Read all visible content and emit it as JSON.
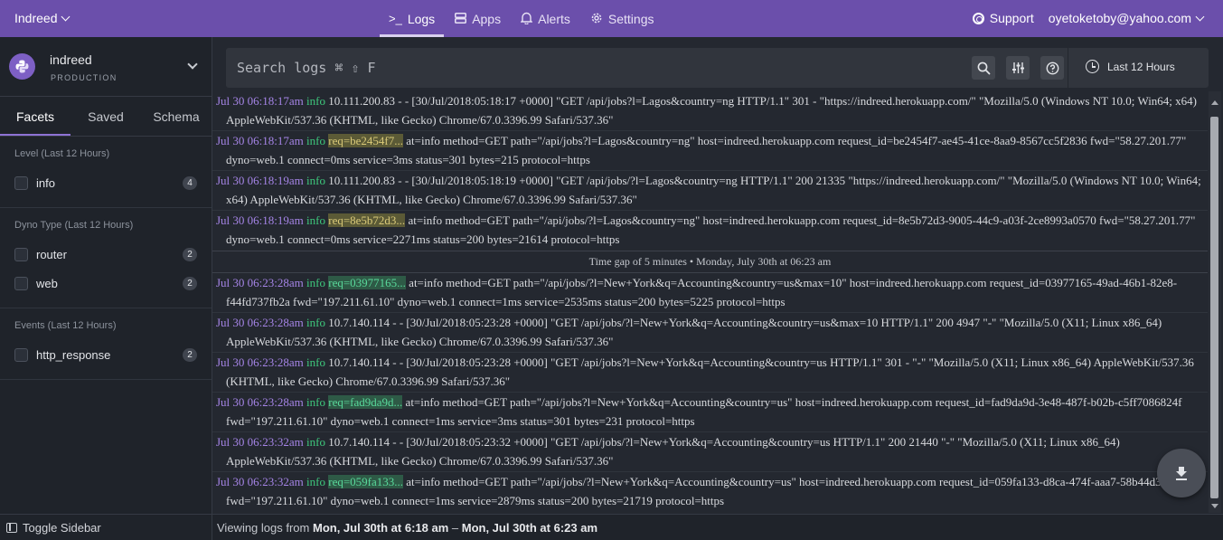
{
  "topbar": {
    "app_switcher": "Indreed",
    "nav": [
      {
        "label": "Logs",
        "icon": "terminal-icon"
      },
      {
        "label": "Apps",
        "icon": "apps-icon"
      },
      {
        "label": "Alerts",
        "icon": "bell-icon"
      },
      {
        "label": "Settings",
        "icon": "gear-icon"
      }
    ],
    "support": "Support",
    "user": "oyetoketoby@yahoo.com",
    "accent_color": "#6b4fab"
  },
  "sidebar": {
    "app": {
      "name": "indreed",
      "env": "PRODUCTION"
    },
    "tabs": [
      "Facets",
      "Saved",
      "Schema"
    ],
    "groups": [
      {
        "title": "Level (Last 12 Hours)",
        "items": [
          {
            "label": "info",
            "count": "4"
          }
        ]
      },
      {
        "title": "Dyno Type (Last 12 Hours)",
        "items": [
          {
            "label": "router",
            "count": "2"
          },
          {
            "label": "web",
            "count": "2"
          }
        ]
      },
      {
        "title": "Events (Last 12 Hours)",
        "items": [
          {
            "label": "http_response",
            "count": "2"
          }
        ]
      }
    ],
    "toggle_label": "Toggle Sidebar"
  },
  "search": {
    "placeholder": "Search logs ⌘ ⇧ F",
    "time_range": "Last 12 Hours"
  },
  "logs": [
    {
      "ts": "Jul 30 06:18:17am",
      "level": "info",
      "req": "",
      "text": "10.111.200.83 - - [30/Jul/2018:05:18:17 +0000] \"GET /api/jobs?l=Lagos&country=ng HTTP/1.1\" 301 - \"https://indreed.herokuapp.com/\" \"Mozilla/5.0 (Windows NT 10.0; Win64; x64) AppleWebKit/537.36 (KHTML, like Gecko) Chrome/67.0.3396.99 Safari/537.36\""
    },
    {
      "ts": "Jul 30 06:18:17am",
      "level": "info",
      "req": "req=be2454f7...",
      "req_style": "y",
      "text": "at=info method=GET path=\"/api/jobs?l=Lagos&country=ng\" host=indreed.herokuapp.com request_id=be2454f7-ae45-41ce-8aa9-8567cc5f2836 fwd=\"58.27.201.77\" dyno=web.1 connect=0ms service=3ms status=301 bytes=215 protocol=https"
    },
    {
      "ts": "Jul 30 06:18:19am",
      "level": "info",
      "req": "",
      "text": "10.111.200.83 - - [30/Jul/2018:05:18:19 +0000] \"GET /api/jobs/?l=Lagos&country=ng HTTP/1.1\" 200 21335 \"https://indreed.herokuapp.com/\" \"Mozilla/5.0 (Windows NT 10.0; Win64; x64) AppleWebKit/537.36 (KHTML, like Gecko) Chrome/67.0.3396.99 Safari/537.36\""
    },
    {
      "ts": "Jul 30 06:18:19am",
      "level": "info",
      "req": "req=8e5b72d3...",
      "req_style": "y",
      "text": "at=info method=GET path=\"/api/jobs/?l=Lagos&country=ng\" host=indreed.herokuapp.com request_id=8e5b72d3-9005-44c9-a03f-2ce8993a0570 fwd=\"58.27.201.77\" dyno=web.1 connect=0ms service=2271ms status=200 bytes=21614 protocol=https"
    },
    {
      "ts": "Jul 30 06:23:28am",
      "level": "info",
      "req": "req=03977165...",
      "req_style": "g",
      "text": "at=info method=GET path=\"/api/jobs/?l=New+York&q=Accounting&country=us&max=10\" host=indreed.herokuapp.com request_id=03977165-49ad-46b1-82e8-f44fd737fb2a fwd=\"197.211.61.10\" dyno=web.1 connect=1ms service=2535ms status=200 bytes=5225 protocol=https"
    },
    {
      "ts": "Jul 30 06:23:28am",
      "level": "info",
      "req": "",
      "text": "10.7.140.114 - - [30/Jul/2018:05:23:28 +0000] \"GET /api/jobs/?l=New+York&q=Accounting&country=us&max=10 HTTP/1.1\" 200 4947 \"-\" \"Mozilla/5.0 (X11; Linux x86_64) AppleWebKit/537.36 (KHTML, like Gecko) Chrome/67.0.3396.99 Safari/537.36\""
    },
    {
      "ts": "Jul 30 06:23:28am",
      "level": "info",
      "req": "",
      "text": "10.7.140.114 - - [30/Jul/2018:05:23:28 +0000] \"GET /api/jobs?l=New+York&q=Accounting&country=us HTTP/1.1\" 301 - \"-\" \"Mozilla/5.0 (X11; Linux x86_64) AppleWebKit/537.36 (KHTML, like Gecko) Chrome/67.0.3396.99 Safari/537.36\""
    },
    {
      "ts": "Jul 30 06:23:28am",
      "level": "info",
      "req": "req=fad9da9d...",
      "req_style": "g",
      "text": "at=info method=GET path=\"/api/jobs?l=New+York&q=Accounting&country=us\" host=indreed.herokuapp.com request_id=fad9da9d-3e48-487f-b02b-c5ff7086824f fwd=\"197.211.61.10\" dyno=web.1 connect=1ms service=3ms status=301 bytes=231 protocol=https"
    },
    {
      "ts": "Jul 30 06:23:32am",
      "level": "info",
      "req": "",
      "text": "10.7.140.114 - - [30/Jul/2018:05:23:32 +0000] \"GET /api/jobs/?l=New+York&q=Accounting&country=us HTTP/1.1\" 200 21440 \"-\" \"Mozilla/5.0 (X11; Linux x86_64) AppleWebKit/537.36 (KHTML, like Gecko) Chrome/67.0.3396.99 Safari/537.36\""
    },
    {
      "ts": "Jul 30 06:23:32am",
      "level": "info",
      "req": "req=059fa133...",
      "req_style": "g",
      "text": "at=info method=GET path=\"/api/jobs/?l=New+York&q=Accounting&country=us\" host=indreed.herokuapp.com request_id=059fa133-d8ca-474f-aaa7-58b44d3cbefd fwd=\"197.211.61.10\" dyno=web.1 connect=1ms service=2879ms status=200 bytes=21719 protocol=https"
    }
  ],
  "time_gap": "Time gap of 5 minutes • Monday, July 30th at 06:23 am",
  "footer": {
    "prefix": "Viewing logs from",
    "from": "Mon, Jul 30th at 6:18 am",
    "sep": "–",
    "to": "Mon, Jul 30th at 6:23 am"
  }
}
